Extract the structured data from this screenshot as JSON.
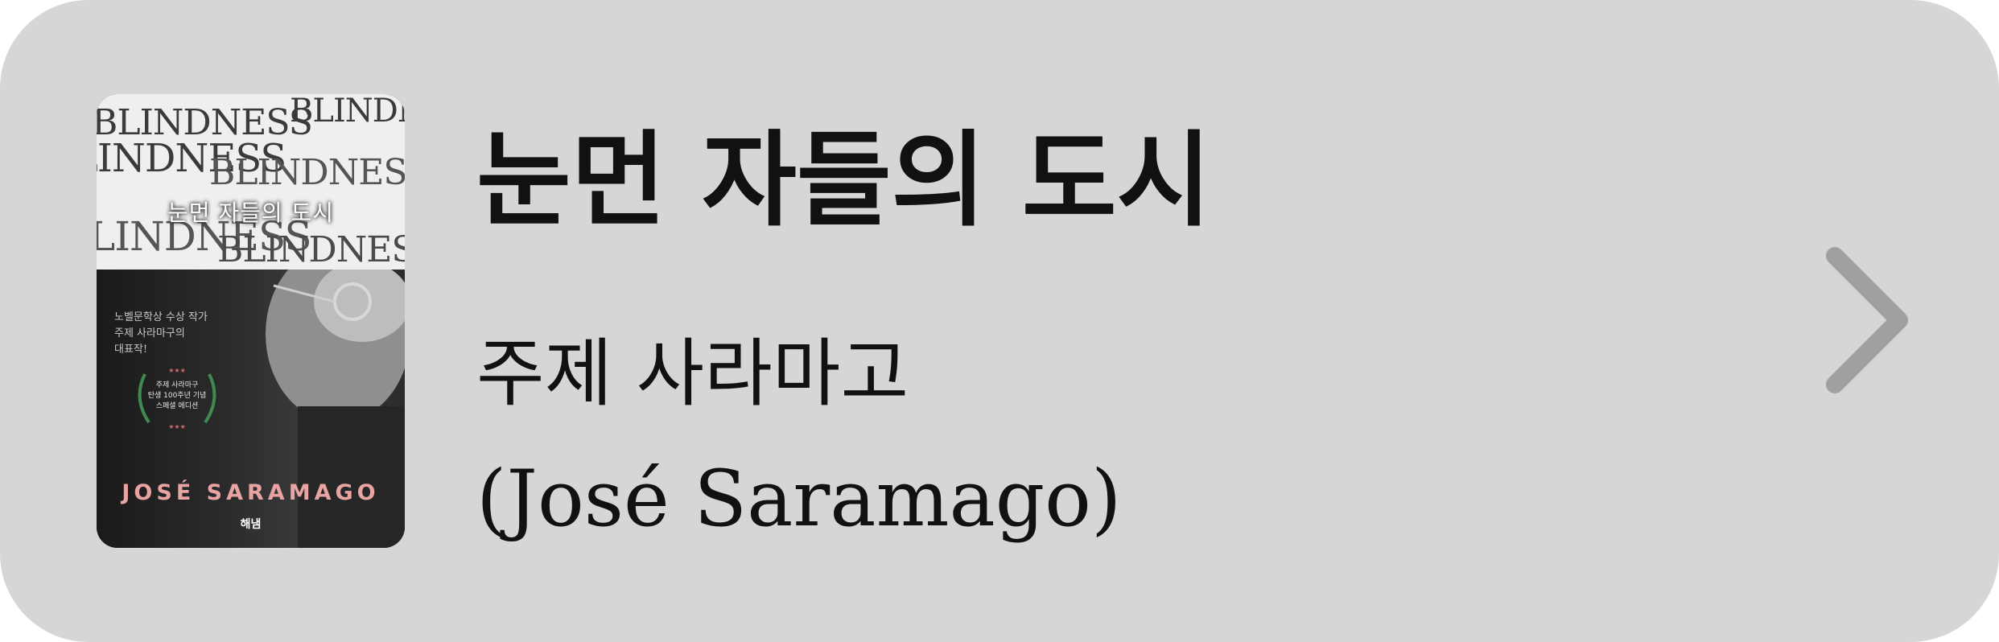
{
  "book": {
    "title": "눈먼 자들의 도시",
    "author_korean": "주제 사라마고",
    "author_original": "(José Saramago)"
  },
  "cover": {
    "title": "눈먼 자들의 도시",
    "background_words": [
      "BLINDNESS",
      "BLINDN",
      "LINDNESS",
      "BLINDNESS",
      "LINDNESS",
      "BLINDNESS"
    ],
    "blurb": "노벨문학상 수상 작가\n주제 사라마구의\n대표작!",
    "laurel_text": "주제 사라마구\n탄생 100주년 기념\n스페셜 에디션",
    "author": "JOSÉ SARAMAGO",
    "publisher": "해냄"
  },
  "icons": {
    "chevron": "chevron-right-icon"
  },
  "colors": {
    "card_background": "#d6d6d6",
    "chevron": "#a0a0a0",
    "text": "#111111"
  }
}
